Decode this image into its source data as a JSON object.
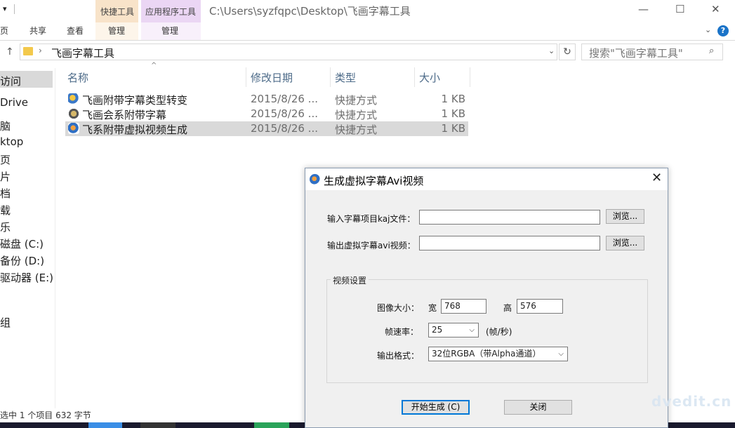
{
  "window": {
    "title_path": "C:\\Users\\syzfqpc\\Desktop\\飞画字幕工具",
    "ribbon_tabs": [
      "页",
      "共享",
      "查看",
      "管理",
      "管理"
    ],
    "context_labels": [
      "快捷工具",
      "应用程序工具"
    ],
    "window_buttons": {
      "minimize": "—",
      "maximize": "☐",
      "close": "✕"
    }
  },
  "address": {
    "folder": "飞画字幕工具",
    "refresh": "↻",
    "search_placeholder": "搜索\"飞画字幕工具\""
  },
  "nav": {
    "items": [
      "访问",
      "Drive",
      "脑",
      "ktop",
      "页",
      "片",
      "档",
      "载",
      "乐",
      "磁盘 (C:)",
      "备份 (D:)",
      "驱动器 (E:)",
      "组"
    ]
  },
  "list": {
    "headers": {
      "name": "名称",
      "date": "修改日期",
      "type": "类型",
      "size": "大小"
    },
    "rows": [
      {
        "name": "飞画附带字幕类型转变",
        "date": "2015/8/26 ...",
        "type": "快捷方式",
        "size": "1 KB"
      },
      {
        "name": "飞画会系附带字幕",
        "date": "2015/8/26 ...",
        "type": "快捷方式",
        "size": "1 KB"
      },
      {
        "name": "飞系附带虚拟视频生成",
        "date": "2015/8/26 ...",
        "type": "快捷方式",
        "size": "1 KB"
      }
    ]
  },
  "status": {
    "text": "选中 1 个项目  632 字节"
  },
  "dialog": {
    "title": "生成虚拟字幕Avi视频",
    "close": "✕",
    "input_label": "输入字幕项目kaj文件：",
    "output_label": "输出虚拟字幕avi视频：",
    "input_value": "",
    "output_value": "",
    "browse_label": "浏览...",
    "group_title": "视频设置",
    "size_label": "图像大小：",
    "width_label": "宽",
    "width_value": "768",
    "height_label": "高",
    "height_value": "576",
    "fps_label": "帧速率：",
    "fps_value": "25",
    "fps_unit": "(帧/秒)",
    "format_label": "输出格式：",
    "format_value": "32位RGBA（带Alpha通道）",
    "start_button": "开始生成 (C)",
    "close_button": "关闭"
  },
  "watermark": "dvedit.cn"
}
